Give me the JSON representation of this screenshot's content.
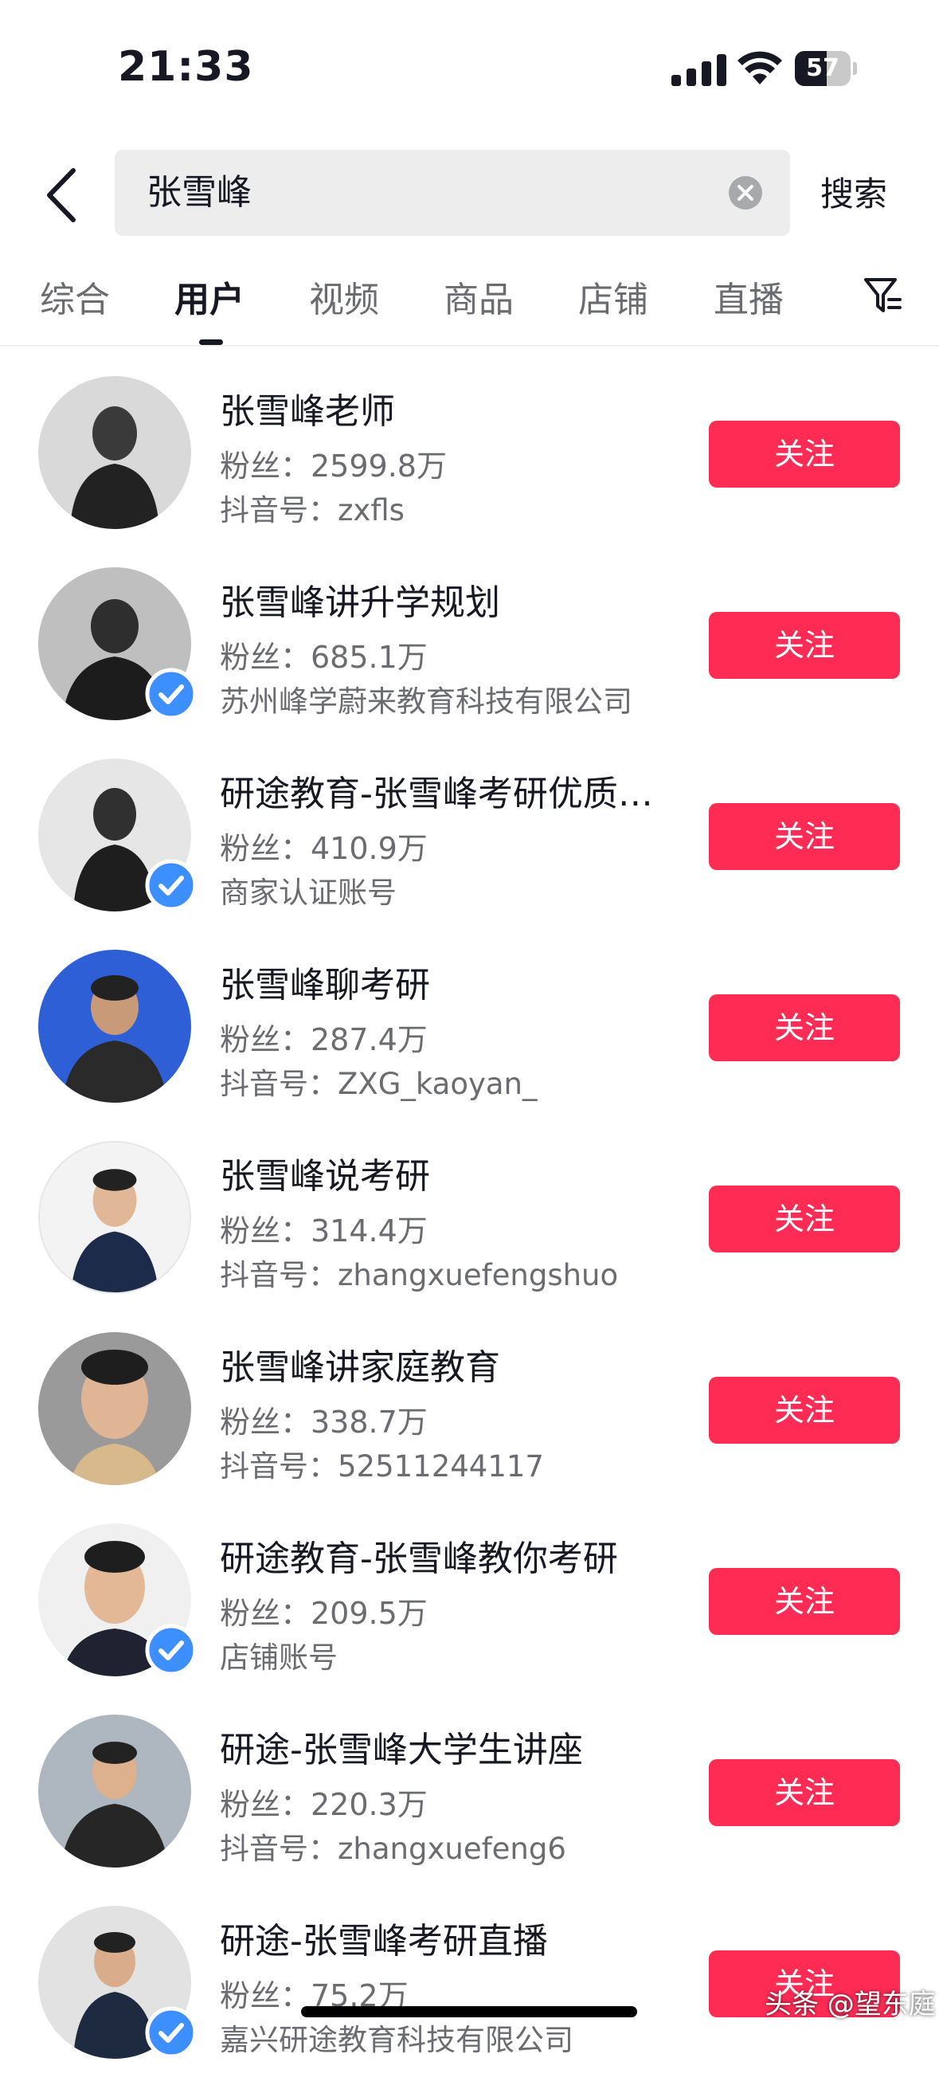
{
  "status": {
    "time": "21:33",
    "battery": "57",
    "battery_level": 0.57
  },
  "search": {
    "query": "张雪峰",
    "submit_label": "搜索"
  },
  "tabs": [
    {
      "label": "综合"
    },
    {
      "label": "用户"
    },
    {
      "label": "视频"
    },
    {
      "label": "商品"
    },
    {
      "label": "店铺"
    },
    {
      "label": "直播"
    }
  ],
  "active_tab": "用户",
  "users": [
    {
      "name": "张雪峰老师",
      "fans": "粉丝：2599.8万",
      "sub": "抖音号：zxfls",
      "verified": false,
      "follow": "关注",
      "avatar_bg": "#d9d9d9"
    },
    {
      "name": "张雪峰讲升学规划",
      "fans": "粉丝：685.1万",
      "sub": "苏州峰学蔚来教育科技有限公司",
      "verified": true,
      "follow": "关注",
      "avatar_bg": "#bfbfbf"
    },
    {
      "name": "研途教育-张雪峰考研优质…",
      "fans": "粉丝：410.9万",
      "sub": "商家认证账号",
      "verified": true,
      "follow": "关注",
      "avatar_bg": "#e6e6e6"
    },
    {
      "name": "张雪峰聊考研",
      "fans": "粉丝：287.4万",
      "sub": "抖音号：ZXG_kaoyan_",
      "verified": false,
      "follow": "关注",
      "avatar_bg": "#2f5fd6"
    },
    {
      "name": "张雪峰说考研",
      "fans": "粉丝：314.4万",
      "sub": "抖音号：zhangxuefengshuo",
      "verified": false,
      "follow": "关注",
      "avatar_bg": "#f3f3f3"
    },
    {
      "name": "张雪峰讲家庭教育",
      "fans": "粉丝：338.7万",
      "sub": "抖音号：52511244117",
      "verified": false,
      "follow": "关注",
      "avatar_bg": "#9a9a9a"
    },
    {
      "name": "研途教育-张雪峰教你考研",
      "fans": "粉丝：209.5万",
      "sub": "店铺账号",
      "verified": true,
      "follow": "关注",
      "avatar_bg": "#f0f0f0"
    },
    {
      "name": "研途-张雪峰大学生讲座",
      "fans": "粉丝：220.3万",
      "sub": "抖音号：zhangxuefeng6",
      "verified": false,
      "follow": "关注",
      "avatar_bg": "#aeb6bf"
    },
    {
      "name": "研途-张雪峰考研直播",
      "fans": "粉丝：75.2万",
      "sub": "嘉兴研途教育科技有限公司",
      "verified": true,
      "follow": "关注",
      "avatar_bg": "#e2e2e2"
    }
  ],
  "watermark": "头条 @望东庭",
  "colors": {
    "accent": "#fe2c55",
    "verified": "#3d8eff",
    "text_primary": "#161823",
    "text_secondary": "#6b6c72"
  }
}
